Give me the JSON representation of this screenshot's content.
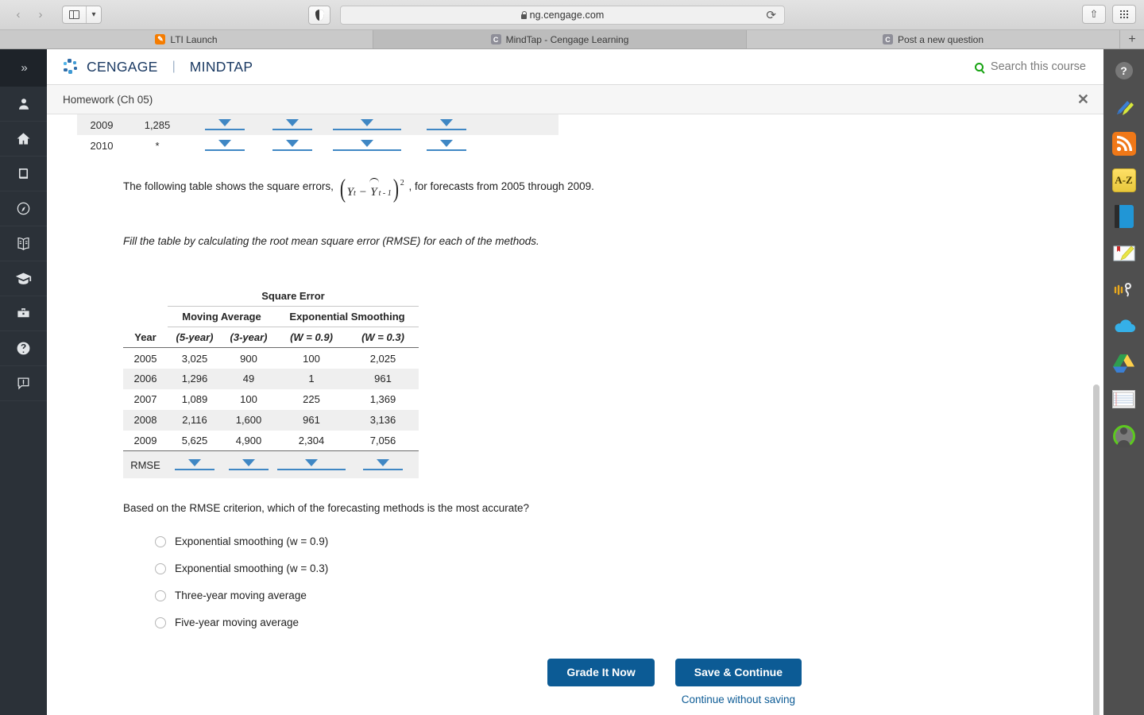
{
  "browser": {
    "url": "ng.cengage.com",
    "nav": {
      "back": "‹",
      "forward": "›"
    },
    "reload_icon": "reload-icon",
    "lock_icon": "lock-icon",
    "tabs": [
      {
        "title": "LTI Launch",
        "favicon": "pencil-favicon",
        "active": false
      },
      {
        "title": "MindTap - Cengage Learning",
        "favicon": "cengage-favicon",
        "active": true
      },
      {
        "title": "Post a new question",
        "favicon": "cengage-favicon",
        "active": false
      }
    ],
    "new_tab_label": "+"
  },
  "left_nav": {
    "expand_label": "»",
    "items": [
      {
        "name": "profile",
        "icon": "person-icon"
      },
      {
        "name": "home",
        "icon": "home-icon"
      },
      {
        "name": "readings",
        "icon": "book-icon"
      },
      {
        "name": "explore",
        "icon": "compass-icon"
      },
      {
        "name": "reader",
        "icon": "open-book-icon"
      },
      {
        "name": "grades",
        "icon": "graduation-cap-icon"
      },
      {
        "name": "career",
        "icon": "briefcase-icon"
      },
      {
        "name": "help",
        "icon": "question-circle-icon"
      },
      {
        "name": "feedback",
        "icon": "alert-chat-icon"
      }
    ]
  },
  "header": {
    "brand_primary": "CENGAGE",
    "brand_secondary": "MINDTAP",
    "search_label": "Search this course",
    "search_icon": "search-icon",
    "help_icon": "help-circle-icon"
  },
  "activity_bar": {
    "title": "Homework (Ch 05)",
    "close_label": "✕"
  },
  "top_table": {
    "rows": [
      {
        "year": "2009",
        "value": "1,285",
        "dropdowns": [
          "",
          "",
          "",
          ""
        ]
      },
      {
        "year": "2010",
        "value": "*",
        "dropdowns": [
          "",
          "",
          "",
          ""
        ]
      }
    ]
  },
  "intro": {
    "text_before": "The following table shows the square errors,",
    "formula": {
      "y": "Y",
      "sub_t": "t",
      "minus": "−",
      "yhat": "Y",
      "sub_t1": "t - 1",
      "exponent": "2"
    },
    "text_after": ", for forecasts from 2005 through 2009.",
    "instruction": "Fill the table by calculating the root mean square error (RMSE) for each of the methods."
  },
  "chart_data": {
    "type": "table",
    "title": "Square Error",
    "group_headers": [
      "Moving Average",
      "Exponential Smoothing"
    ],
    "columns": [
      "Year",
      "(5-year)",
      "(3-year)",
      "(W = 0.9)",
      "(W = 0.3)"
    ],
    "rows": [
      [
        "2005",
        "3,025",
        "900",
        "100",
        "2,025"
      ],
      [
        "2006",
        "1,296",
        "49",
        "1",
        "961"
      ],
      [
        "2007",
        "1,089",
        "100",
        "225",
        "1,369"
      ],
      [
        "2008",
        "2,116",
        "1,600",
        "961",
        "3,136"
      ],
      [
        "2009",
        "5,625",
        "4,900",
        "2,304",
        "7,056"
      ]
    ],
    "footer_label": "RMSE",
    "footer_values": [
      "",
      "",
      "",
      ""
    ]
  },
  "question": {
    "prompt": "Based on the RMSE criterion, which of the forecasting methods is the most accurate?",
    "options": [
      {
        "label": "Exponential smoothing (w = 0.9)",
        "selected": false
      },
      {
        "label": "Exponential smoothing (w = 0.3)",
        "selected": false
      },
      {
        "label": "Three-year moving average",
        "selected": false
      },
      {
        "label": "Five-year moving average",
        "selected": false
      }
    ]
  },
  "actions": {
    "grade_it_now": "Grade It Now",
    "save_continue": "Save & Continue",
    "continue_without_saving": "Continue without saving",
    "accent_color": "#0c5b95"
  },
  "right_bar": {
    "items": [
      {
        "name": "highlighter",
        "icon": "pen-highlighter-icon"
      },
      {
        "name": "rss-feed",
        "icon": "rss-icon"
      },
      {
        "name": "glossary",
        "icon": "a-z-icon"
      },
      {
        "name": "textbook",
        "icon": "blue-book-icon"
      },
      {
        "name": "notes",
        "icon": "notebook-pencil-icon"
      },
      {
        "name": "read-aloud",
        "icon": "read-speaker-icon"
      },
      {
        "name": "onedrive",
        "icon": "cloud-icon"
      },
      {
        "name": "google-drive",
        "icon": "drive-triangle-icon"
      },
      {
        "name": "flashcards",
        "icon": "index-cards-icon"
      },
      {
        "name": "account",
        "icon": "avatar-icon"
      }
    ]
  }
}
